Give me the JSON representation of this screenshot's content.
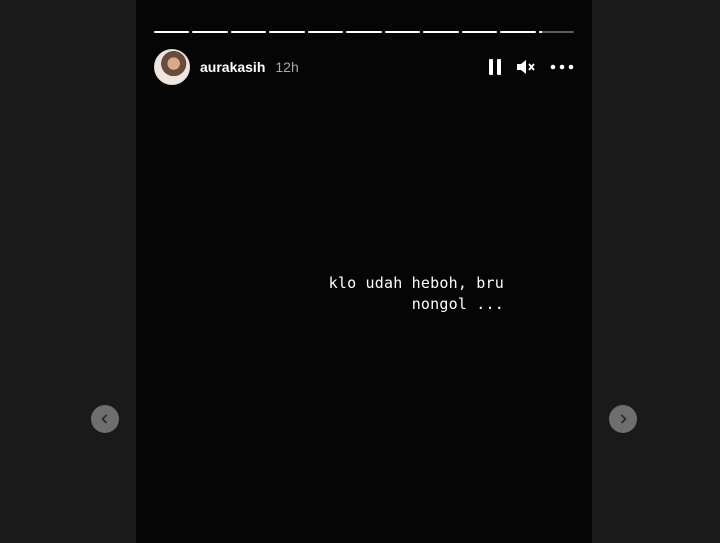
{
  "story": {
    "username": "aurakasih",
    "time": "12h",
    "caption_lines": [
      "klo udah heboh, bru",
      "nongol ..."
    ],
    "segments": [
      1,
      1,
      1,
      1,
      1,
      1,
      1,
      1,
      1,
      1,
      0.1
    ],
    "controls": {
      "pause_icon": "pause-icon",
      "mute_icon": "speaker-muted-icon",
      "more_icon": "more-icon"
    },
    "nav": {
      "prev_icon": "chevron-left-icon",
      "next_icon": "chevron-right-icon"
    }
  }
}
